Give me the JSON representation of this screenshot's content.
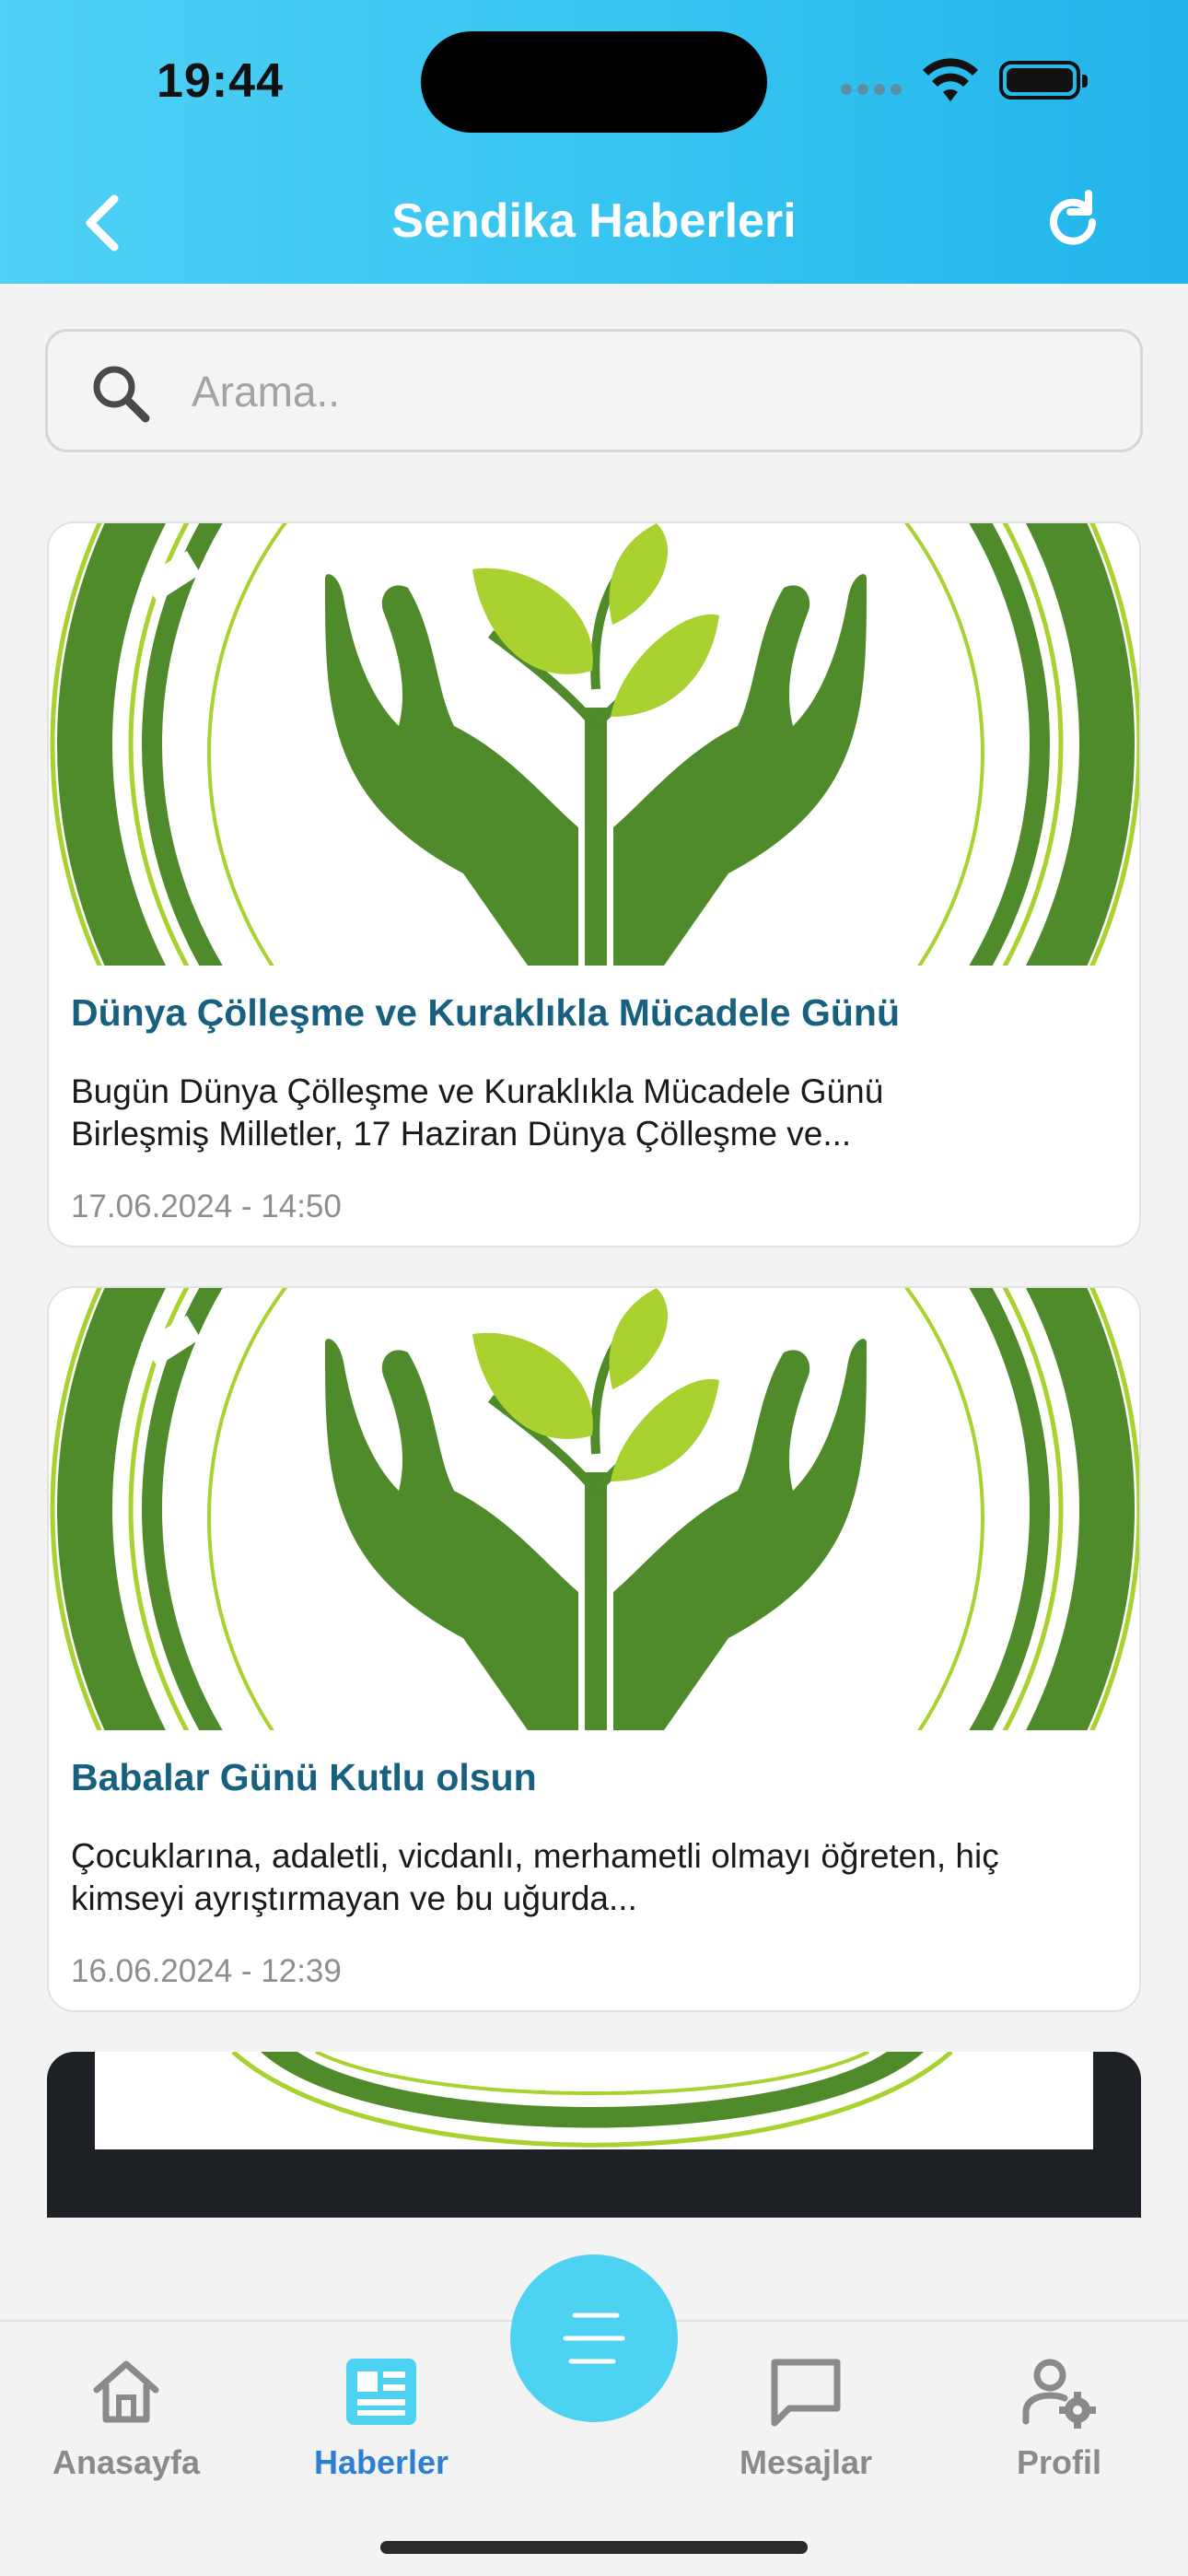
{
  "status_bar": {
    "time": "19:44"
  },
  "header": {
    "title": "Sendika Haberleri"
  },
  "search": {
    "placeholder": "Arama.."
  },
  "news": [
    {
      "title": "Dünya Çölleşme ve Kuraklıkla Mücadele Günü",
      "desc_line1": "Bugün Dünya Çölleşme ve Kuraklıkla Mücadele Günü",
      "desc_line2": "Birleşmiş Milletler, 17 Haziran Dünya Çölleşme ve...",
      "date": "17.06.2024 - 14:50"
    },
    {
      "title": "Babalar Günü Kutlu olsun",
      "desc_line1": "Çocuklarına, adaletli, vicdanlı, merhametli olmayı öğreten, hiç",
      "desc_line2": "kimseyi ayrıştırmayan  ve bu uğurda...",
      "date": "16.06.2024 - 12:39"
    }
  ],
  "bottom_nav": {
    "items": [
      {
        "label": "Anasayfa",
        "icon": "home-icon"
      },
      {
        "label": "Haberler",
        "icon": "news-icon",
        "active": true
      },
      {
        "label": "Mesajlar",
        "icon": "chat-icon"
      },
      {
        "label": "Profil",
        "icon": "user-settings-icon"
      }
    ],
    "center_button": {
      "icon": "menu-lines-icon"
    }
  },
  "colors": {
    "header_gradient_start": "#4fd0f5",
    "header_gradient_end": "#22b4ea",
    "title_blue": "#17607f",
    "active_tab": "#2c7fd2",
    "fab": "#4dd2f2",
    "logo_green": "#4f8a2b",
    "leaf_green": "#a9d12f"
  }
}
